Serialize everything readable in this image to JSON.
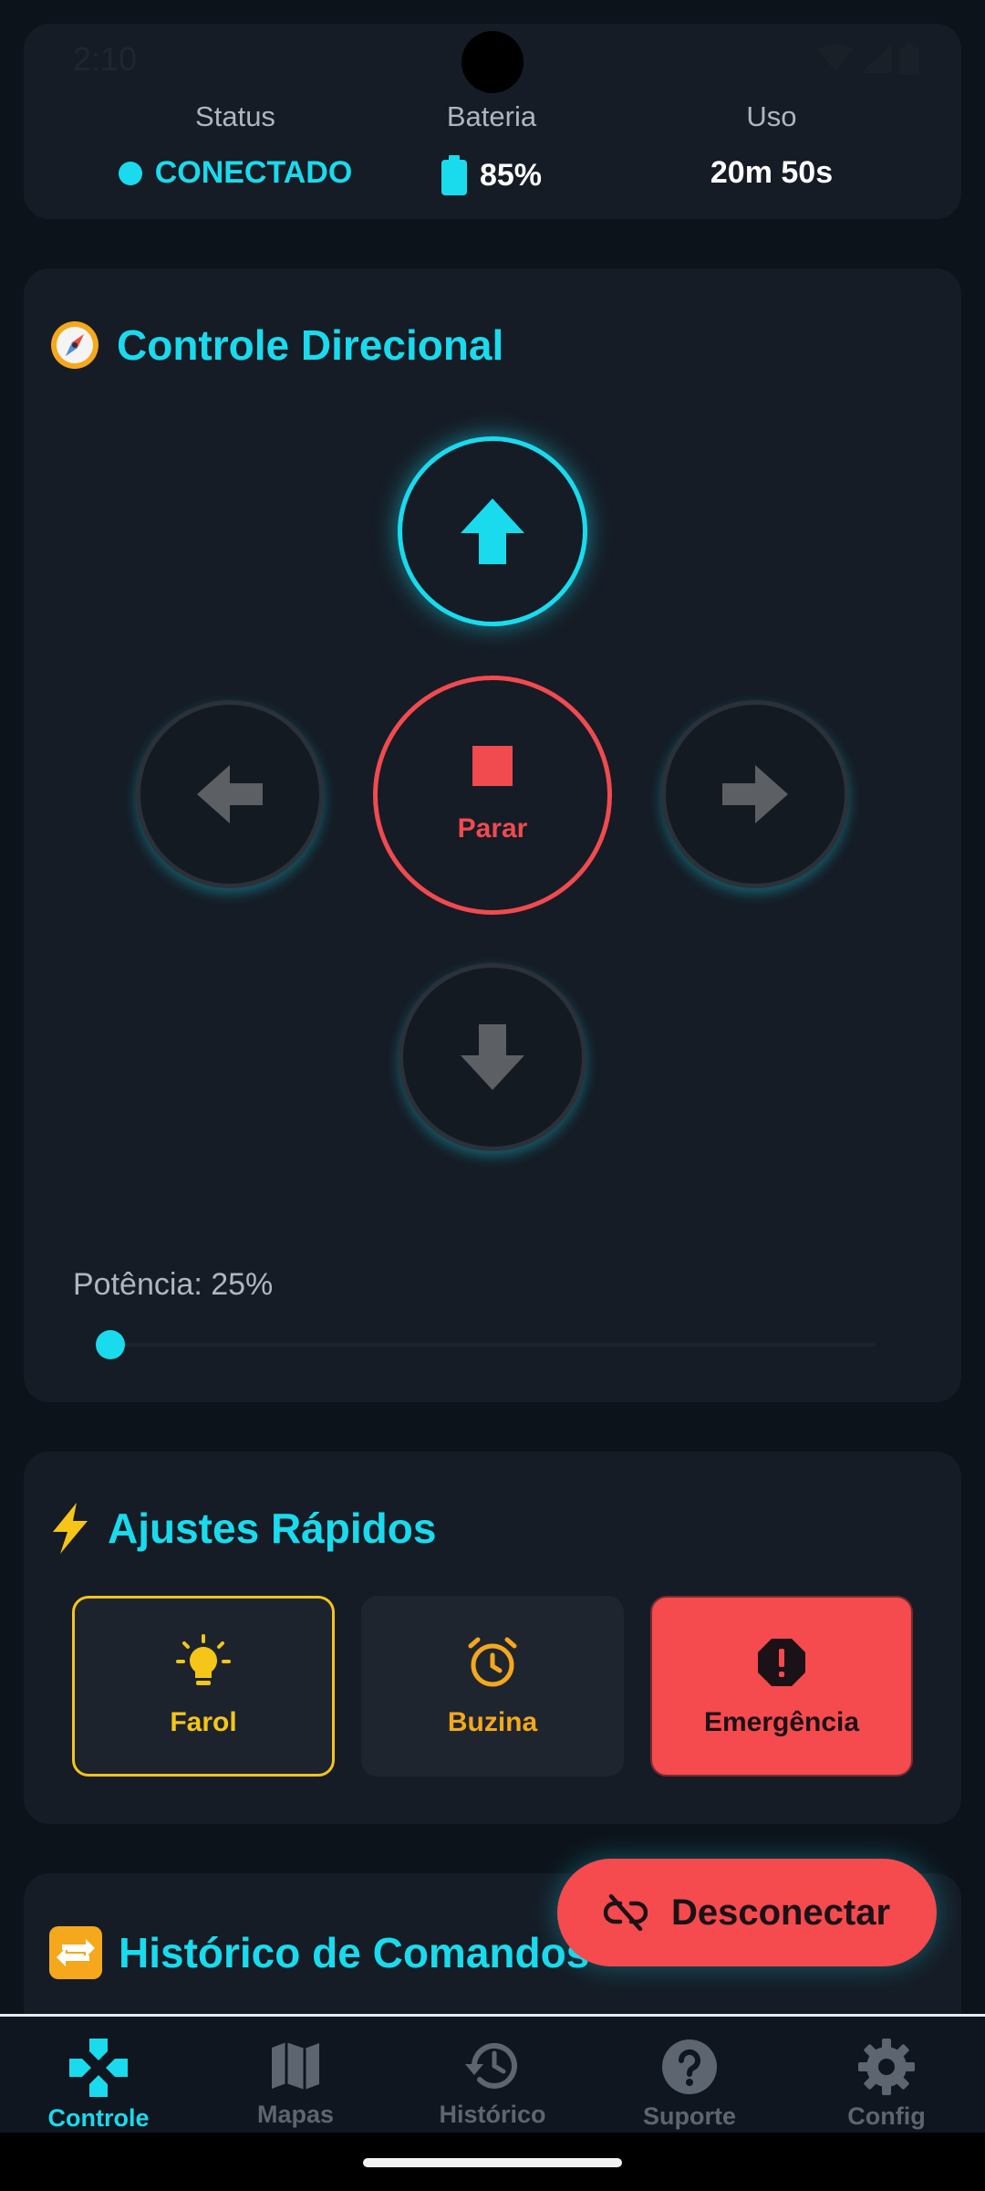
{
  "status_bar": {
    "time": "2:10"
  },
  "status_card": {
    "status": {
      "label": "Status",
      "value": "CONECTADO"
    },
    "battery": {
      "label": "Bateria",
      "value": "85%"
    },
    "usage": {
      "label": "Uso",
      "value": "20m 50s"
    }
  },
  "direction": {
    "title": "Controle Direcional",
    "title_icon": "compass-emoji",
    "stop_label": "Parar",
    "power_label": "Potência: 25%",
    "power_value": 0.25
  },
  "quick": {
    "title": "Ajustes Rápidos",
    "title_icon": "lightning-emoji",
    "items": [
      {
        "label": "Farol",
        "icon": "lightbulb-icon",
        "color": "#f5c518"
      },
      {
        "label": "Buzina",
        "icon": "alarm-clock-icon",
        "color": "#f5a81c"
      },
      {
        "label": "Emergência",
        "icon": "alert-octagon-icon",
        "color": "#f54a4e"
      }
    ]
  },
  "history": {
    "title": "Histórico de Comandos",
    "title_icon": "repeat-emoji"
  },
  "fab": {
    "label": "Desconectar",
    "icon": "link-off-icon"
  },
  "nav": {
    "items": [
      {
        "label": "Controle",
        "icon": "gamepad-icon",
        "active": true
      },
      {
        "label": "Mapas",
        "icon": "map-icon"
      },
      {
        "label": "Histórico",
        "icon": "history-icon"
      },
      {
        "label": "Suporte",
        "icon": "help-circle-icon"
      },
      {
        "label": "Config",
        "icon": "gear-icon"
      }
    ]
  },
  "colors": {
    "accent": "#19dbed",
    "danger": "#f54a4e",
    "background": "#0d131b",
    "card": "#151c26"
  }
}
